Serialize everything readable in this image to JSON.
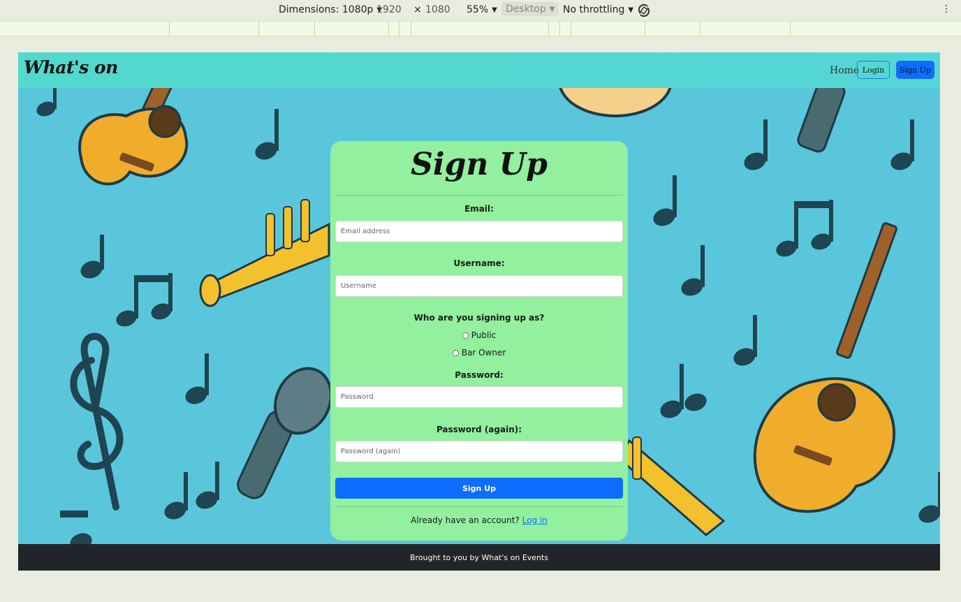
{
  "devtools": {
    "dimensions_label": "Dimensions: 1080p",
    "width": "1920",
    "times": "×",
    "height": "1080",
    "zoom": "55%",
    "device_mode": "Desktop",
    "throttling": "No throttling",
    "caret": "▼",
    "more": "⋮"
  },
  "header": {
    "brand": "What's on",
    "nav": {
      "home": "Home",
      "login": "Login",
      "signup": "Sign Up"
    }
  },
  "form": {
    "title": "Sign Up",
    "email_label": "Email:",
    "email_placeholder": "Email address",
    "username_label": "Username:",
    "username_placeholder": "Username",
    "role_question": "Who are you signing up as?",
    "role_options": [
      "Public",
      "Bar Owner"
    ],
    "password_label": "Password:",
    "password_placeholder": "Password",
    "password2_label": "Password (again):",
    "password2_placeholder": "Password (again)",
    "submit_label": "Sign Up",
    "login_prompt": "Already have an account?",
    "login_link": "Log in"
  },
  "footer": {
    "text": "Brought to you by What's on Events"
  },
  "colors": {
    "header_bg": "#52d8cc",
    "hero_bg": "#5ac6dc",
    "card_bg": "#92f09e",
    "primary": "#0d6efd",
    "footer_bg": "#212529"
  }
}
